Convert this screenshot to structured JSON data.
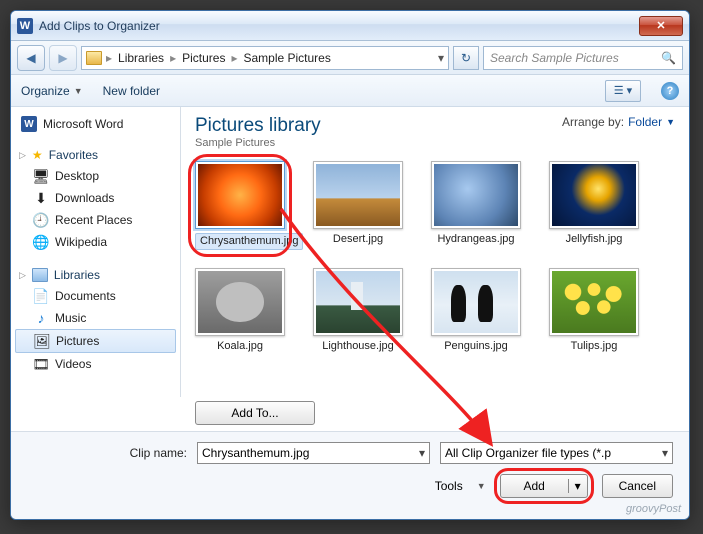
{
  "window": {
    "title": "Add Clips to Organizer"
  },
  "nav": {
    "crumbs": [
      "Libraries",
      "Pictures",
      "Sample Pictures"
    ],
    "search_placeholder": "Search Sample Pictures"
  },
  "toolbar": {
    "organize": "Organize",
    "new_folder": "New folder"
  },
  "sidebar": {
    "app": "Microsoft Word",
    "favorites_label": "Favorites",
    "favorites": [
      "Desktop",
      "Downloads",
      "Recent Places",
      "Wikipedia"
    ],
    "libraries_label": "Libraries",
    "libraries": [
      "Documents",
      "Music",
      "Pictures",
      "Videos"
    ],
    "selected": "Pictures"
  },
  "content": {
    "library_title": "Pictures library",
    "library_subtitle": "Sample Pictures",
    "arrange_label": "Arrange by:",
    "arrange_value": "Folder",
    "thumbs": [
      {
        "name": "Chrysanthemum.jpg",
        "selected": true
      },
      {
        "name": "Desert.jpg"
      },
      {
        "name": "Hydrangeas.jpg"
      },
      {
        "name": "Jellyfish.jpg"
      },
      {
        "name": "Koala.jpg"
      },
      {
        "name": "Lighthouse.jpg"
      },
      {
        "name": "Penguins.jpg"
      },
      {
        "name": "Tulips.jpg"
      }
    ]
  },
  "bottom": {
    "add_to": "Add To...",
    "clip_name_label": "Clip name:",
    "clip_name_value": "Chrysanthemum.jpg",
    "filetype_value": "All Clip Organizer file types  (*.p",
    "tools_label": "Tools",
    "add_label": "Add",
    "cancel_label": "Cancel"
  },
  "watermark": "groovyPost"
}
